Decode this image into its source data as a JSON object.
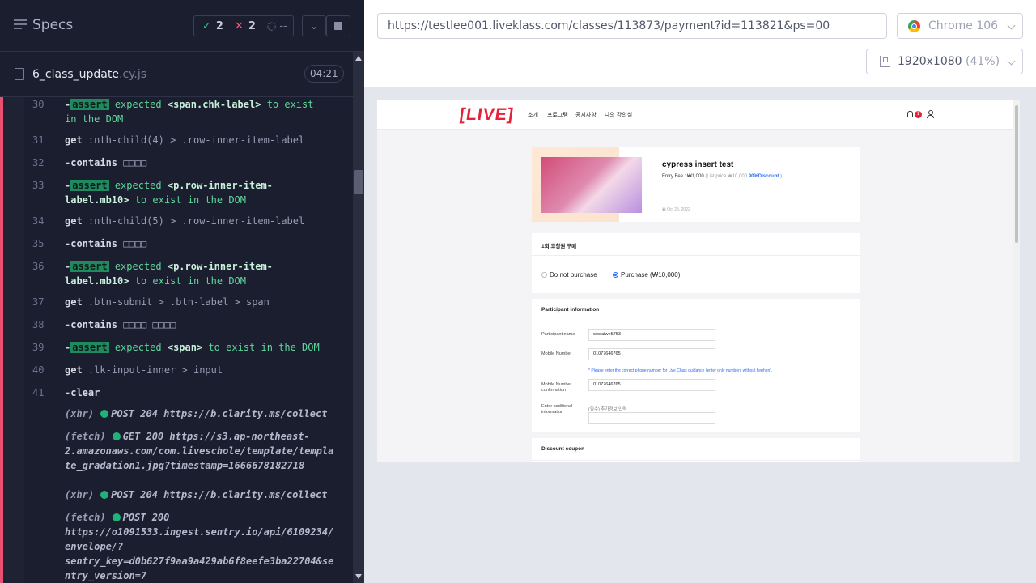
{
  "runner": {
    "title": "Specs",
    "passed": "2",
    "failed": "2",
    "pending": "--",
    "spec_file": "6_class_update",
    "spec_ext": ".cy.js",
    "duration": "04:21"
  },
  "log": [
    {
      "num": "30",
      "parts": [
        [
          "dash",
          "-"
        ],
        [
          "badge",
          "assert"
        ],
        [
          "green",
          "expected"
        ],
        [
          "greenb",
          "<span.chk-label>"
        ],
        [
          "green",
          "to exist"
        ]
      ],
      "cont": [
        [
          "green",
          "in the DOM"
        ]
      ]
    },
    {
      "num": "31",
      "parts": [
        [
          "cmd",
          "get"
        ],
        [
          "muted",
          ":nth-child(4) > .row-inner-item-label"
        ]
      ]
    },
    {
      "num": "32",
      "parts": [
        [
          "cmd",
          "-contains"
        ],
        [
          "muted",
          "□□□□"
        ]
      ]
    },
    {
      "num": "33",
      "parts": [
        [
          "dash",
          "-"
        ],
        [
          "badge",
          "assert"
        ],
        [
          "green",
          "expected"
        ],
        [
          "greenb",
          "<p.row-inner-item-"
        ]
      ],
      "cont": [
        [
          "greenb",
          "label.mb10>"
        ],
        [
          "green",
          "to exist in the DOM"
        ]
      ]
    },
    {
      "num": "34",
      "parts": [
        [
          "cmd",
          "get"
        ],
        [
          "muted",
          ":nth-child(5) > .row-inner-item-label"
        ]
      ]
    },
    {
      "num": "35",
      "parts": [
        [
          "cmd",
          "-contains"
        ],
        [
          "muted",
          "□□□□"
        ]
      ]
    },
    {
      "num": "36",
      "parts": [
        [
          "dash",
          "-"
        ],
        [
          "badge",
          "assert"
        ],
        [
          "green",
          "expected"
        ],
        [
          "greenb",
          "<p.row-inner-item-"
        ]
      ],
      "cont": [
        [
          "greenb",
          "label.mb10>"
        ],
        [
          "green",
          "to exist in the DOM"
        ]
      ]
    },
    {
      "num": "37",
      "parts": [
        [
          "cmd",
          "get"
        ],
        [
          "muted",
          ".btn-submit > .btn-label > span"
        ]
      ]
    },
    {
      "num": "38",
      "parts": [
        [
          "cmd",
          "-contains"
        ],
        [
          "muted",
          "□□□□ □□□□"
        ]
      ]
    },
    {
      "num": "39",
      "parts": [
        [
          "dash",
          "-"
        ],
        [
          "badge",
          "assert"
        ],
        [
          "green",
          "expected"
        ],
        [
          "greenb",
          "<span>"
        ],
        [
          "green",
          "to exist in the DOM"
        ]
      ]
    },
    {
      "num": "40",
      "parts": [
        [
          "cmd",
          "get"
        ],
        [
          "muted",
          ".lk-input-inner > input"
        ]
      ]
    },
    {
      "num": "41",
      "parts": [
        [
          "cmd",
          "-clear"
        ]
      ]
    }
  ],
  "network": [
    {
      "tag": "(xhr)",
      "lines": [
        "POST 204 https://b.clarity.ms/collect"
      ]
    },
    {
      "tag": "(fetch)",
      "lines": [
        "GET 200 https://s3.ap-northeast-",
        "2.amazonaws.com/com.liveschole/template/templa",
        "te_gradation1.jpg?timestamp=1666678182718"
      ]
    },
    {
      "tag": "(xhr)",
      "lines": [
        "POST 204 https://b.clarity.ms/collect"
      ]
    },
    {
      "tag": "(fetch)",
      "lines": [
        "POST 200",
        "https://o1091533.ingest.sentry.io/api/6109234/",
        "envelope/?",
        "sentry_key=d0b627f9aa9a429ab6f8eefe3ba22704&se",
        "ntry_version=7"
      ]
    }
  ],
  "browser": {
    "url": "https://testlee001.liveklass.com/classes/113873/payment?id=113821&ps=00",
    "name": "Chrome 106",
    "viewport": "1920x1080",
    "scale": "(41%)"
  },
  "site": {
    "logo": "LIVE",
    "menu": [
      "소개",
      "프로그램",
      "공지사항",
      "나의 강의실"
    ],
    "notif_count": "1",
    "class_title": "cypress insert test",
    "fee_label": "Entry Fee :",
    "fee_price": "₩1,000",
    "fee_list": "(List price ₩10,000",
    "fee_discount": "90%Discount",
    "fee_close": ")",
    "class_date": "Oct 25, 2022",
    "option_title": "1회 코칭권 구매",
    "opt_no": "Do not purchase",
    "opt_yes": "Purchase (₩10,000)",
    "participant_title": "Participant information",
    "name_label": "Participant name",
    "name_value": "wodafwe5753",
    "mobile_label": "Mobile Number",
    "mobile_value": "01077646765",
    "mobile_hint": "* Please enter the correct phone number for Live Class guidance (enter only numbers without hyphen).",
    "confirm_label": "Mobile Number confirmation",
    "confirm_value": "01077646765",
    "extra_label": "Enter additional information",
    "extra_placeholder": "(필수) 추가정보 입력",
    "coupon_title": "Discount coupon"
  }
}
